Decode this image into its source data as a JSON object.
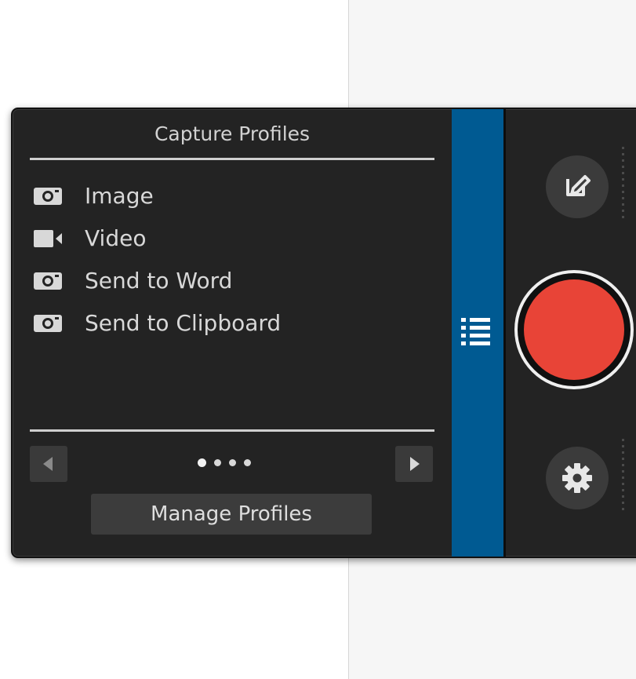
{
  "panel": {
    "title": "Capture Profiles",
    "profiles": [
      {
        "label": "Image",
        "icon": "camera-icon"
      },
      {
        "label": "Video",
        "icon": "video-camera-icon"
      },
      {
        "label": "Send to Word",
        "icon": "camera-icon"
      },
      {
        "label": "Send to Clipboard",
        "icon": "camera-icon"
      }
    ],
    "pager": {
      "pages": 4,
      "current": 1
    },
    "manage_label": "Manage Profiles"
  },
  "colors": {
    "panel_bg": "#232323",
    "tab_blue": "#005a92",
    "record_red": "#e84437"
  },
  "icons": {
    "tab": "list-icon",
    "edit": "edit-icon",
    "record": "record-icon",
    "settings": "gear-icon"
  }
}
